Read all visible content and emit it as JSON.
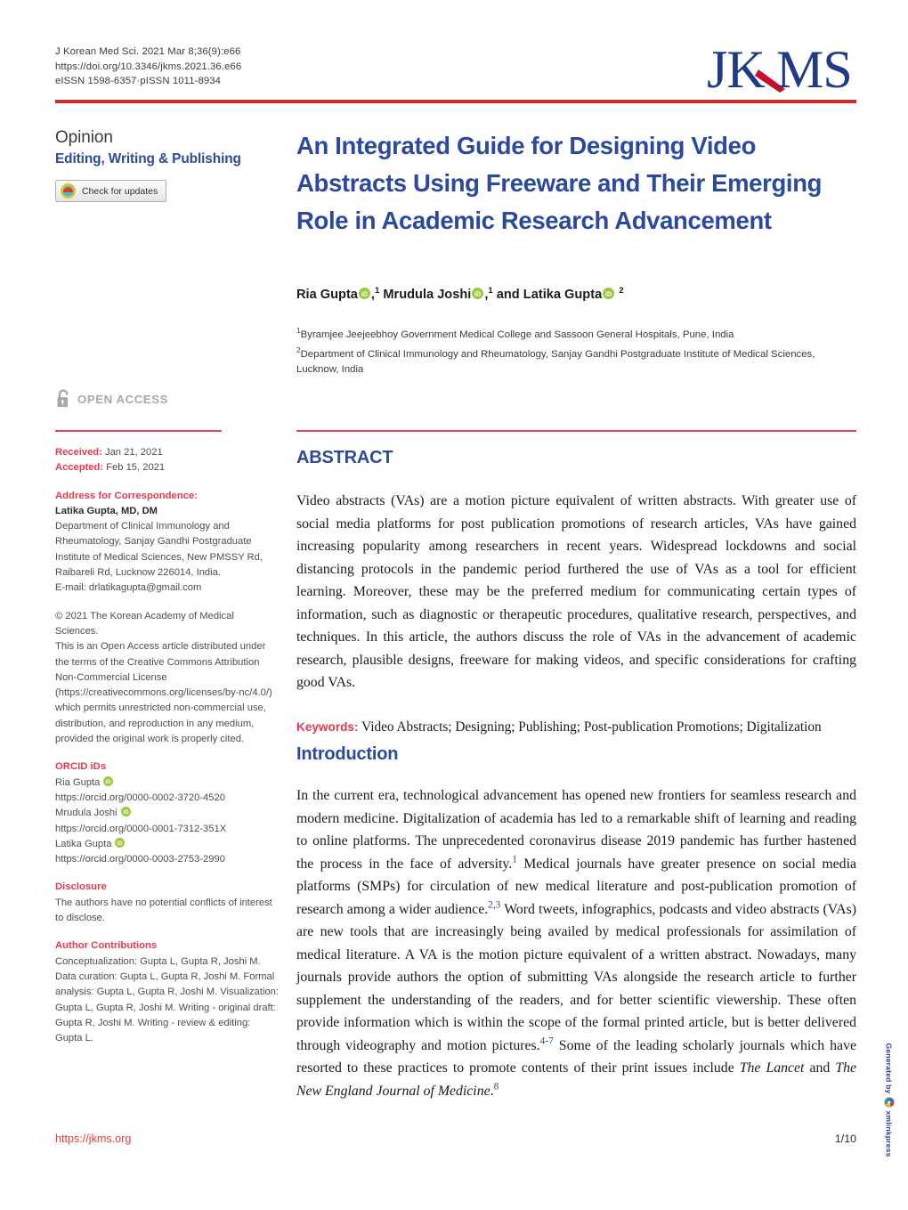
{
  "header": {
    "citation_line": "J Korean Med Sci. 2021 Mar 8;36(9):e66",
    "doi_line": "https://doi.org/10.3346/jkms.2021.36.e66",
    "issn_line": "eISSN 1598-6357·pISSN 1011-8934",
    "logo_text": "JKMS",
    "logo_color": "#1f3a87",
    "logo_accent_color": "#c8102e",
    "rule_color": "#d02b2b"
  },
  "sidebar": {
    "article_type": "Opinion",
    "section": "Editing, Writing & Publishing",
    "crossmark_label": "Check for updates",
    "open_access_label": "OPEN ACCESS",
    "received_label": "Received:",
    "received_date": "Jan 21, 2021",
    "accepted_label": "Accepted:",
    "accepted_date": "Feb 15, 2021",
    "correspondence_heading": "Address for Correspondence:",
    "correspondence_name": "Latika Gupta, MD, DM",
    "correspondence_address": "Department of Clinical Immunology and Rheumatology, Sanjay Gandhi Postgraduate Institute of Medical Sciences, New PMSSY Rd, Raibareli Rd, Lucknow 226014, India.",
    "correspondence_email": "E-mail: drlatikagupta@gmail.com",
    "copyright_line": "© 2021 The Korean Academy of Medical Sciences.",
    "license_text": "This is an Open Access article distributed under the terms of the Creative Commons Attribution Non-Commercial License (https://creativecommons.org/licenses/by-nc/4.0/) which permits unrestricted non-commercial use, distribution, and reproduction in any medium, provided the original work is properly cited.",
    "orcid_heading": "ORCID iDs",
    "orcids": [
      {
        "name": "Ria Gupta",
        "url": "https://orcid.org/0000-0002-3720-4520"
      },
      {
        "name": "Mrudula Joshi",
        "url": "https://orcid.org/0000-0001-7312-351X"
      },
      {
        "name": "Latika Gupta",
        "url": "https://orcid.org/0000-0003-2753-2990"
      }
    ],
    "disclosure_heading": "Disclosure",
    "disclosure_text": "The authors have no potential conflicts of interest to disclose.",
    "contributions_heading": "Author Contributions",
    "contributions_text": "Conceptualization: Gupta L, Gupta R, Joshi M. Data curation: Gupta L, Gupta R, Joshi M. Formal analysis: Gupta L, Gupta R, Joshi M. Visualization: Gupta L, Gupta R, Joshi M. Writing - original draft: Gupta R, Joshi M. Writing - review & editing: Gupta L.",
    "heading_color": "#e8384f"
  },
  "article": {
    "title": "An Integrated Guide for Designing Video Abstracts Using Freeware and Their Emerging Role in Academic Research Advancement",
    "title_color": "#2b4a9e",
    "authors": [
      {
        "name": "Ria Gupta",
        "affiliation_mark": "1"
      },
      {
        "name": "Mrudula Joshi",
        "affiliation_mark": "1"
      },
      {
        "name": "Latika Gupta",
        "affiliation_mark": "2"
      }
    ],
    "authors_conjunction": "and",
    "affiliations": [
      {
        "mark": "1",
        "text": "Byramjee Jeejeebhoy Government Medical College and Sassoon General Hospitals, Pune, India"
      },
      {
        "mark": "2",
        "text": "Department of Clinical Immunology and Rheumatology, Sanjay Gandhi Postgraduate Institute of Medical Sciences, Lucknow, India"
      }
    ]
  },
  "abstract": {
    "heading": "ABSTRACT",
    "paragraph": "Video abstracts (VAs) are a motion picture equivalent of written abstracts. With greater use of social media platforms for post publication promotions of research articles, VAs have gained increasing popularity among researchers in recent years. Widespread lockdowns and social distancing protocols in the pandemic period furthered the use of VAs as a tool for efficient learning. Moreover, these may be the preferred medium for communicating certain types of information, such as diagnostic or therapeutic procedures, qualitative research, perspectives, and techniques. In this article, the authors discuss the role of VAs in the advancement of academic research, plausible designs, freeware for making videos, and specific considerations for crafting good VAs.",
    "keywords_label": "Keywords:",
    "keywords_text": "Video Abstracts; Designing; Publishing; Post-publication Promotions; Digitalization"
  },
  "introduction": {
    "heading": "Introduction",
    "part1": "In the current era, technological advancement has opened new frontiers for seamless research and modern medicine. Digitalization of academia has led to a remarkable shift of learning and reading to online platforms. The unprecedented coronavirus disease 2019 pandemic has further hastened the process in the face of adversity.",
    "cite1": "1",
    "part2": " Medical journals have greater presence on social media platforms (SMPs) for circulation of new medical literature and post-publication promotion of research among a wider audience.",
    "cite2": "2,3",
    "part3": " Word tweets, infographics, podcasts and video abstracts (VAs) are new tools that are increasingly being availed by medical professionals for assimilation of medical literature. A VA is the motion picture equivalent of a written abstract. Nowadays, many journals provide authors the option of submitting VAs alongside the research article to further supplement the understanding of the readers, and for better scientific viewership. These often provide information which is within the scope of the formal printed article, but is better delivered through videography and motion pictures.",
    "cite3": "4-7",
    "part4": " Some of the leading scholarly journals which have resorted to these practices to promote contents of their print issues include ",
    "journal1": "The Lancet",
    "part5": " and ",
    "journal2": "The New England Journal of Medicine",
    "part6": ".",
    "cite4": "8"
  },
  "footer": {
    "url": "https://jkms.org",
    "page_number": "1/10",
    "url_color": "#ee3b3b"
  },
  "vertical_strip": {
    "generated_by": "Generated by",
    "vendor": "xmlinkpress"
  }
}
